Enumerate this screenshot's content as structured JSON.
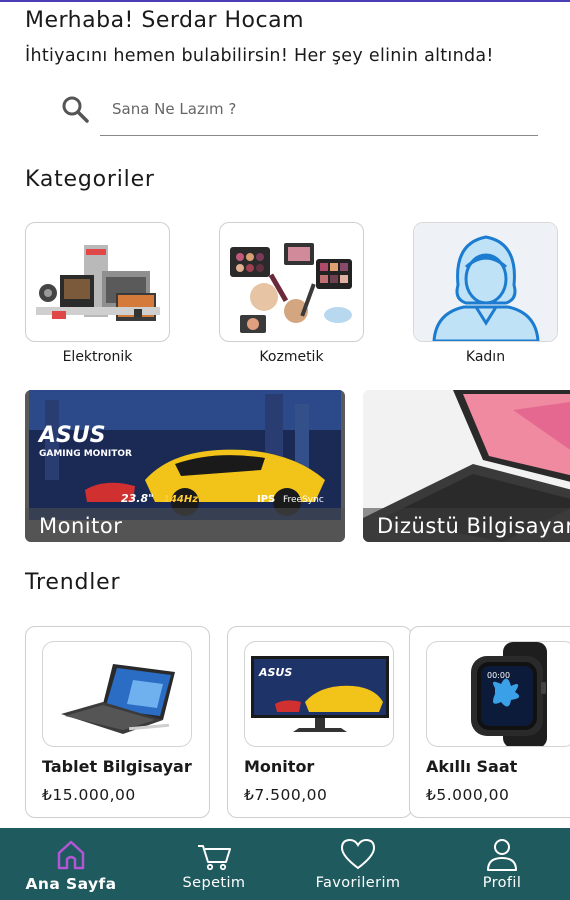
{
  "header": {
    "greeting": "Merhaba! Serdar Hocam",
    "subtitle": "İhtiyacını hemen bulabilirsin! Her şey elinin altında!"
  },
  "search": {
    "placeholder": "Sana Ne Lazım ?",
    "icon": "search-icon"
  },
  "categories": {
    "title": "Kategoriler",
    "items": [
      {
        "label": "Elektronik"
      },
      {
        "label": "Kozmetik"
      },
      {
        "label": "Kadın"
      }
    ]
  },
  "banners": {
    "items": [
      {
        "label": "Monitor",
        "art_brand": "ASUS",
        "art_sub": "GAMING MONITOR",
        "art_size": "23.8\"",
        "art_hz": "144Hz",
        "art_ips": "IPS",
        "art_sync": "FreeSync"
      },
      {
        "label": "Dizüstü Bilgisayar"
      }
    ]
  },
  "trends": {
    "title": "Trendler",
    "items": [
      {
        "name": "Tablet Bilgisayar",
        "price": "₺15.000,00"
      },
      {
        "name": "Monitor",
        "price": "₺7.500,00",
        "art_brand": "ASUS"
      },
      {
        "name": "Akıllı Saat",
        "price": "₺5.000,00",
        "art_time": "00:00"
      }
    ]
  },
  "nav": {
    "items": [
      {
        "label": "Ana Sayfa",
        "icon": "home-icon",
        "active": true
      },
      {
        "label": "Sepetim",
        "icon": "cart-icon",
        "active": false
      },
      {
        "label": "Favorilerim",
        "icon": "heart-icon",
        "active": false
      },
      {
        "label": "Profil",
        "icon": "profile-icon",
        "active": false
      }
    ]
  },
  "colors": {
    "nav_bg": "#1f5a5f",
    "nav_active_icon": "#b455d6",
    "top_accent": "#4b3fb8"
  }
}
